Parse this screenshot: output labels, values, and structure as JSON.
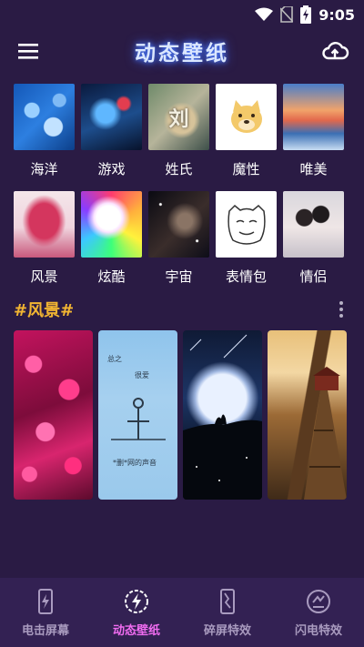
{
  "status_bar": {
    "time": "9:05"
  },
  "header": {
    "title": "动态壁纸"
  },
  "categories": [
    {
      "label": "海洋"
    },
    {
      "label": "游戏"
    },
    {
      "label": "姓氏"
    },
    {
      "label": "魔性"
    },
    {
      "label": "唯美"
    },
    {
      "label": "风景"
    },
    {
      "label": "炫酷"
    },
    {
      "label": "宇宙"
    },
    {
      "label": "表情包"
    },
    {
      "label": "情侣"
    }
  ],
  "name_tile_text": "刘",
  "section": {
    "title": "#风景#"
  },
  "wallpapers": {
    "card2": {
      "line1": "总之",
      "line2": "很爱",
      "line3": "*删*网的声音"
    }
  },
  "bottom_nav": [
    {
      "label": "电击屏幕",
      "active": false
    },
    {
      "label": "动态壁纸",
      "active": true
    },
    {
      "label": "碎屏特效",
      "active": false
    },
    {
      "label": "闪电特效",
      "active": false
    }
  ],
  "colors": {
    "background": "#2a1b44",
    "nav_background": "#332153",
    "section_title": "#f2b632",
    "nav_active": "#f06cf0",
    "nav_inactive": "#a99bbf"
  }
}
